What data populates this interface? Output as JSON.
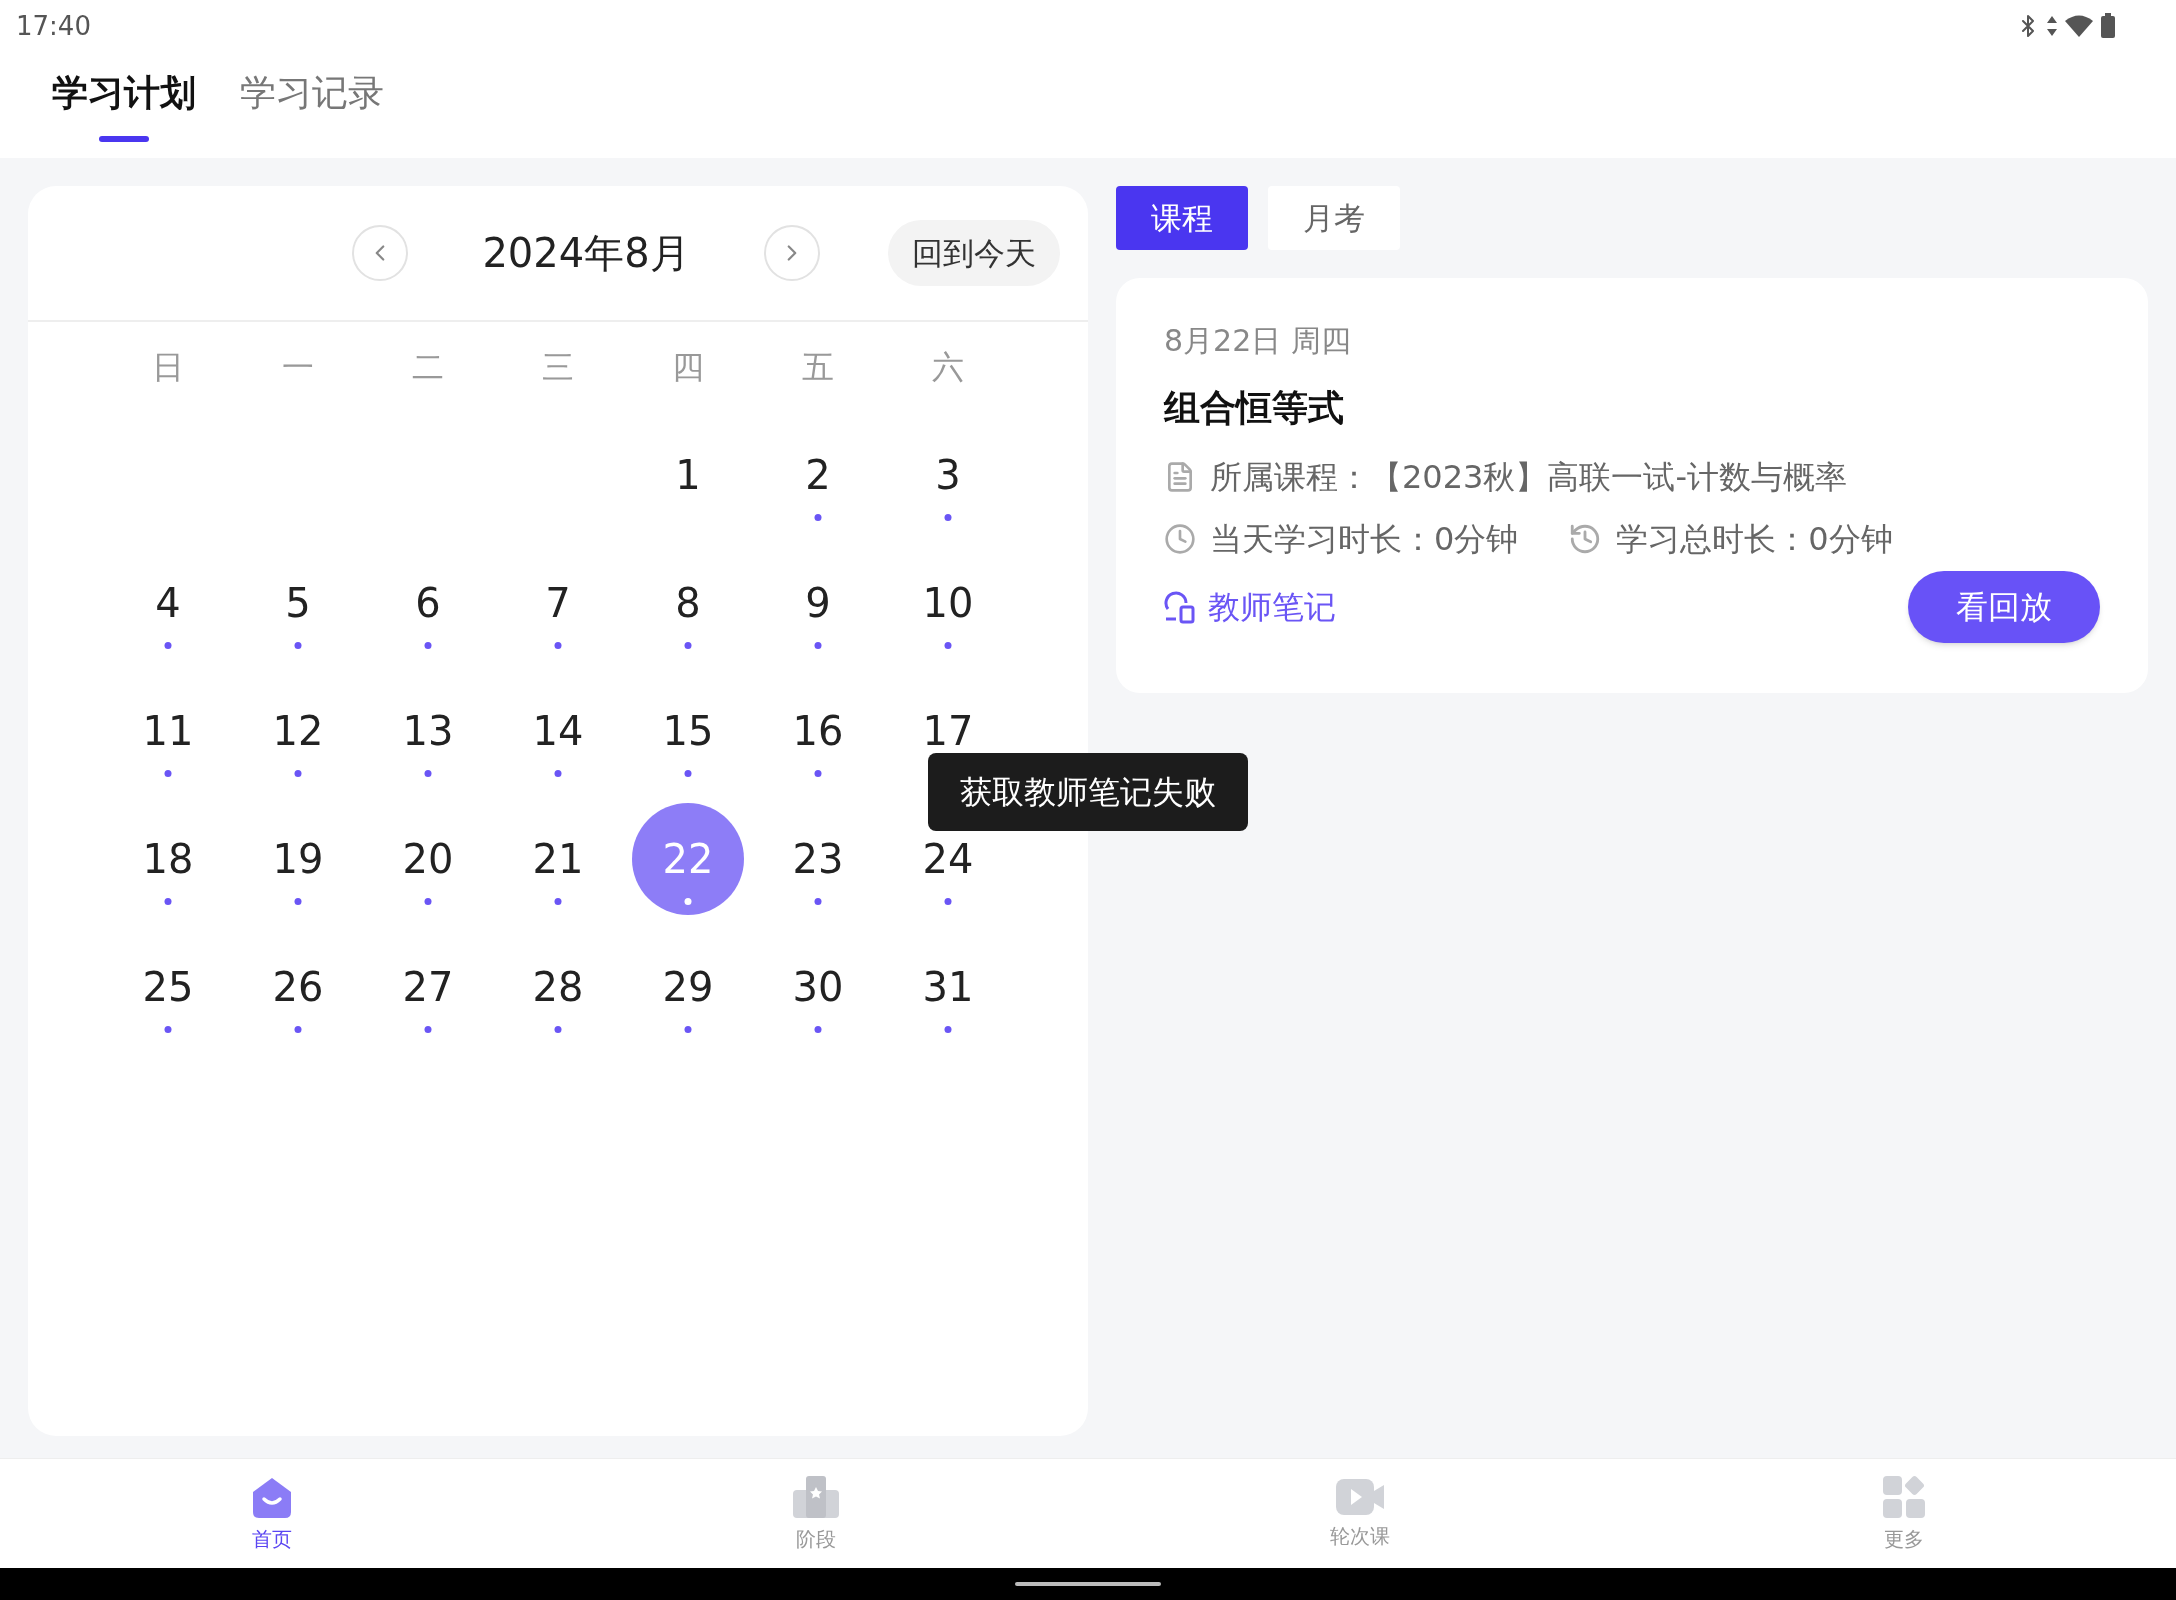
{
  "status_bar": {
    "time": "17:40"
  },
  "tabs": [
    {
      "label": "学习计划",
      "selected": true
    },
    {
      "label": "学习记录",
      "selected": false
    }
  ],
  "calendar": {
    "title": "2024年8月",
    "today_button": "回到今天",
    "weekdays": [
      "日",
      "一",
      "二",
      "三",
      "四",
      "五",
      "六"
    ],
    "weeks": [
      [
        {
          "kind": "blank"
        },
        {
          "kind": "blank"
        },
        {
          "kind": "blank"
        },
        {
          "kind": "blank"
        },
        {
          "kind": "day",
          "label": "1",
          "marked": false,
          "selected": false
        },
        {
          "kind": "day",
          "label": "2",
          "marked": true,
          "selected": false
        },
        {
          "kind": "day",
          "label": "3",
          "marked": true,
          "selected": false
        }
      ],
      [
        {
          "kind": "day",
          "label": "4",
          "marked": true,
          "selected": false
        },
        {
          "kind": "day",
          "label": "5",
          "marked": true,
          "selected": false
        },
        {
          "kind": "day",
          "label": "6",
          "marked": true,
          "selected": false
        },
        {
          "kind": "day",
          "label": "7",
          "marked": true,
          "selected": false
        },
        {
          "kind": "day",
          "label": "8",
          "marked": true,
          "selected": false
        },
        {
          "kind": "day",
          "label": "9",
          "marked": true,
          "selected": false
        },
        {
          "kind": "day",
          "label": "10",
          "marked": true,
          "selected": false
        }
      ],
      [
        {
          "kind": "day",
          "label": "11",
          "marked": true,
          "selected": false
        },
        {
          "kind": "day",
          "label": "12",
          "marked": true,
          "selected": false
        },
        {
          "kind": "day",
          "label": "13",
          "marked": true,
          "selected": false
        },
        {
          "kind": "day",
          "label": "14",
          "marked": true,
          "selected": false
        },
        {
          "kind": "day",
          "label": "15",
          "marked": true,
          "selected": false
        },
        {
          "kind": "day",
          "label": "16",
          "marked": true,
          "selected": false
        },
        {
          "kind": "day",
          "label": "17",
          "selected": false
        }
      ],
      [
        {
          "kind": "day",
          "label": "18",
          "marked": true,
          "selected": false
        },
        {
          "kind": "day",
          "label": "19",
          "marked": true,
          "selected": false
        },
        {
          "kind": "day",
          "label": "20",
          "marked": true,
          "selected": false
        },
        {
          "kind": "day",
          "label": "21",
          "marked": true,
          "selected": false
        },
        {
          "kind": "day",
          "label": "22",
          "marked": true,
          "selected": true
        },
        {
          "kind": "day",
          "label": "23",
          "marked": true,
          "selected": false
        },
        {
          "kind": "day",
          "label": "24",
          "marked": true,
          "selected": false
        }
      ],
      [
        {
          "kind": "day",
          "label": "25",
          "marked": true,
          "selected": false
        },
        {
          "kind": "day",
          "label": "26",
          "marked": true,
          "selected": false
        },
        {
          "kind": "day",
          "label": "27",
          "marked": true,
          "selected": false
        },
        {
          "kind": "day",
          "label": "28",
          "marked": true,
          "selected": false
        },
        {
          "kind": "day",
          "label": "29",
          "marked": true,
          "selected": false
        },
        {
          "kind": "day",
          "label": "30",
          "marked": true,
          "selected": false
        },
        {
          "kind": "day",
          "label": "31",
          "marked": true,
          "selected": false
        }
      ]
    ]
  },
  "toast": "获取教师笔记失败",
  "segments": [
    {
      "label": "课程",
      "selected": true
    },
    {
      "label": "月考",
      "selected": false
    }
  ],
  "lesson": {
    "date": "8月22日 周四",
    "title": "组合恒等式",
    "course": "所属课程：【2023秋】高联一试-计数与概率",
    "today_time": "当天学习时长：0分钟",
    "total_time": "学习总时长：0分钟",
    "notes_link": "教师笔记",
    "replay_button": "看回放"
  },
  "bottom_nav": [
    {
      "label": "首页",
      "selected": true
    },
    {
      "label": "阶段",
      "selected": false
    },
    {
      "label": "轮次课",
      "selected": false
    },
    {
      "label": "更多",
      "selected": false
    }
  ]
}
